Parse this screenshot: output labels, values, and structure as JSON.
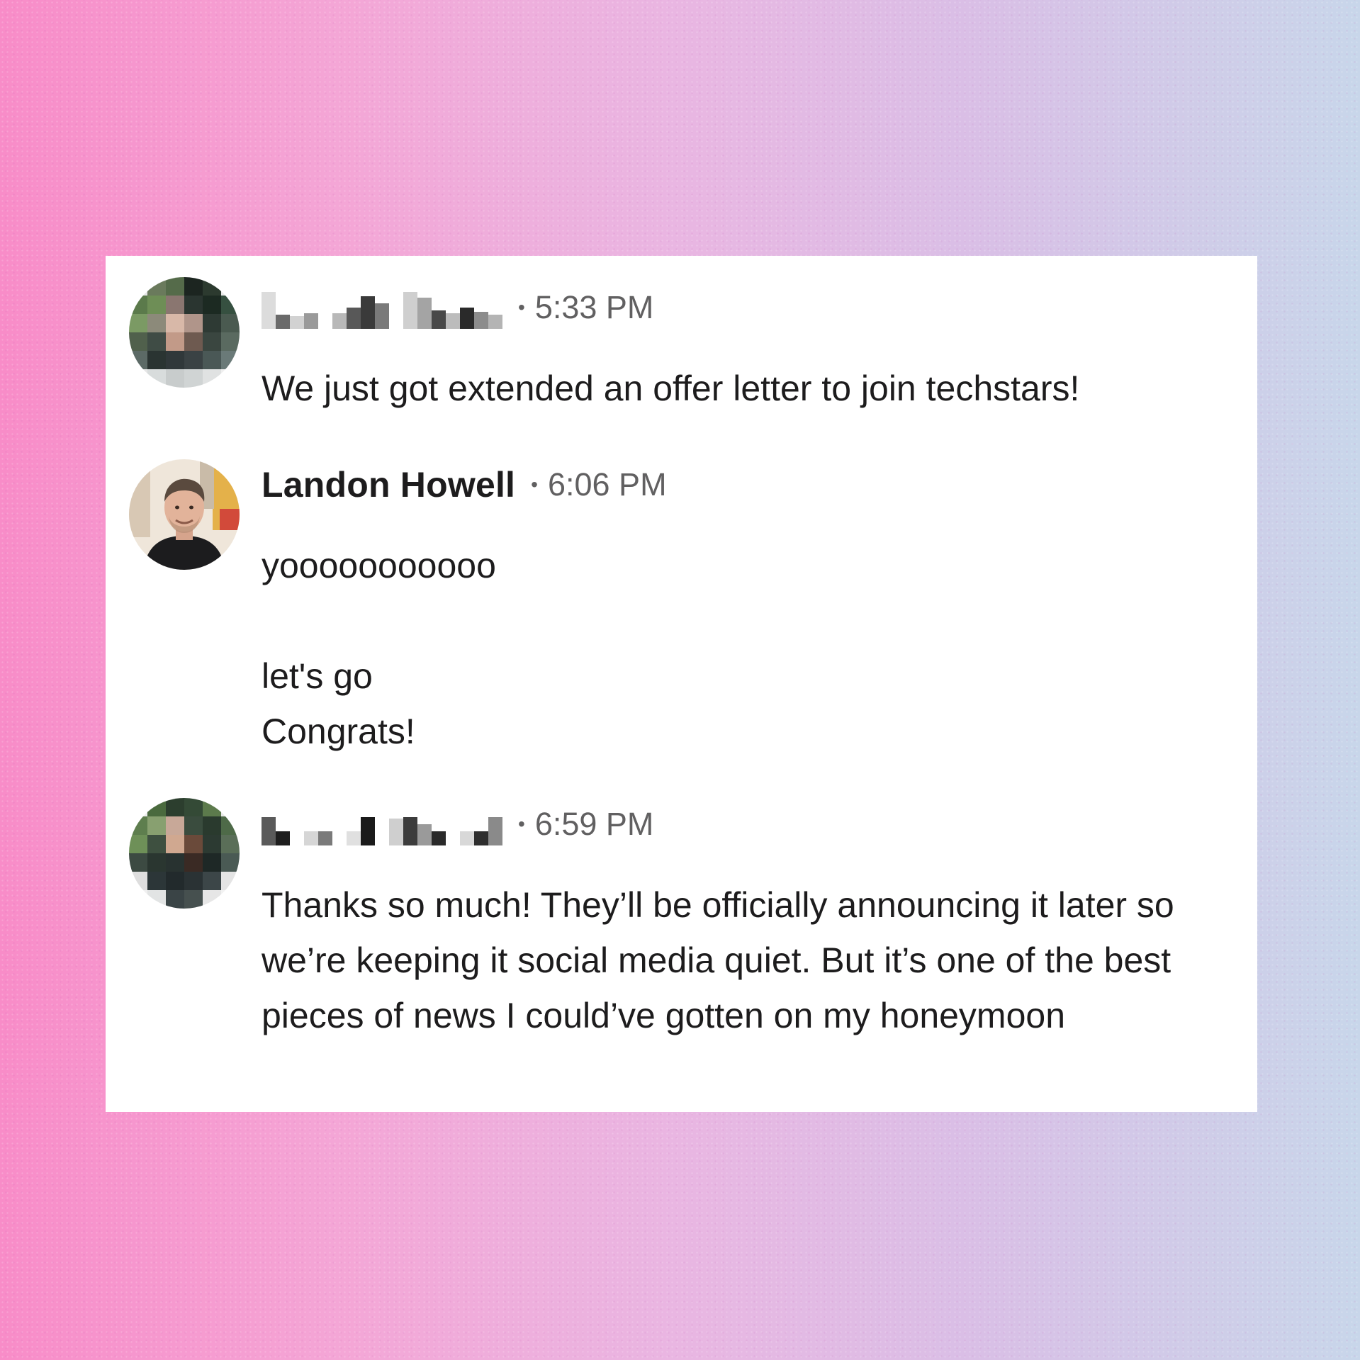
{
  "messages": [
    {
      "sender": "",
      "time": "5:33 PM",
      "lines": [
        "We just got extended an offer letter to join techstars!"
      ]
    },
    {
      "sender": "Landon Howell",
      "time": "6:06 PM",
      "lines": [
        "yooooooooooo",
        "",
        "let's go",
        "Congrats!"
      ]
    },
    {
      "sender": "",
      "time": "6:59 PM",
      "lines": [
        "Thanks so much! They’ll be officially announcing it later so we’re keeping it social media quiet. But it’s one of the best pieces of news I could’ve gotten on my honeymoon"
      ]
    }
  ],
  "separator": "•",
  "colors": {
    "card": "#ffffff",
    "text": "#1d1c1d",
    "muted": "#616061",
    "background_left": "#f88cc8",
    "background_right": "#c8d6ea"
  }
}
